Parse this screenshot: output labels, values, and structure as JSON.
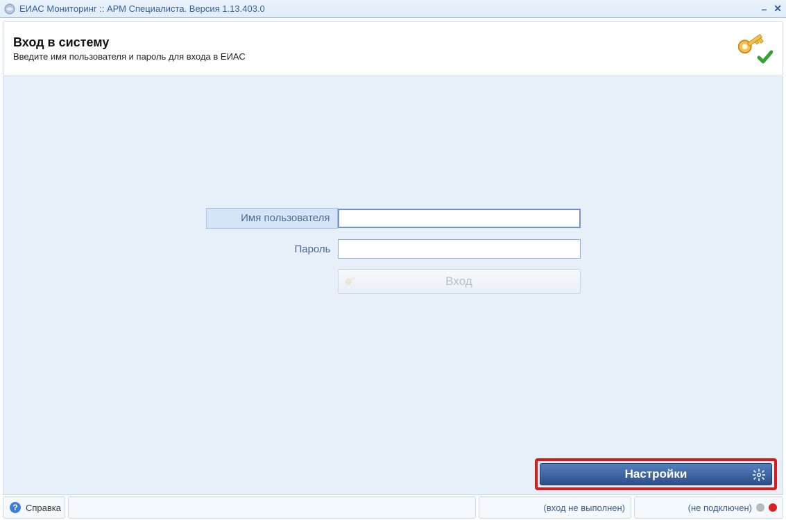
{
  "window": {
    "title": "ЕИАС Мониторинг :: АРМ Специалиста. Версия 1.13.403.0"
  },
  "header": {
    "title": "Вход в систему",
    "subtitle": "Введите имя пользователя и пароль для входа в ЕИАС"
  },
  "form": {
    "username_label": "Имя пользователя",
    "username_value": "",
    "password_label": "Пароль",
    "password_value": "",
    "login_button": "Вход"
  },
  "settings_button": "Настройки",
  "statusbar": {
    "help": "Справка",
    "login_status": "(вход не выполнен)",
    "connection_status": "(не подключен)"
  },
  "colors": {
    "highlight_red": "#d71a1a",
    "accent_blue": "#2c4f8a"
  }
}
